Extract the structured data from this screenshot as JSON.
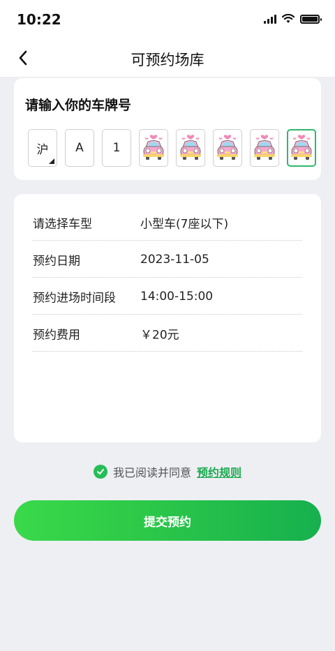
{
  "status_bar": {
    "time": "10:22"
  },
  "header": {
    "title": "可预约场库"
  },
  "plate": {
    "title": "请输入你的车牌号",
    "chars": [
      "沪",
      "A",
      "1"
    ],
    "empty_icon": "cartoon-car-icon"
  },
  "info": {
    "rows": [
      {
        "label": "请选择车型",
        "value": "小型车(7座以下)"
      },
      {
        "label": "预约日期",
        "value": "2023-11-05"
      },
      {
        "label": "预约进场时间段",
        "value": "14:00-15:00"
      },
      {
        "label": "预约费用",
        "value": "￥20元"
      }
    ]
  },
  "agreement": {
    "text": "我已阅读并同意",
    "link": "预约规则",
    "checked": true
  },
  "submit": {
    "label": "提交预约"
  },
  "colors": {
    "accent": "#26bd57",
    "background": "#eeeff3",
    "selected_border": "#2fb86b"
  }
}
